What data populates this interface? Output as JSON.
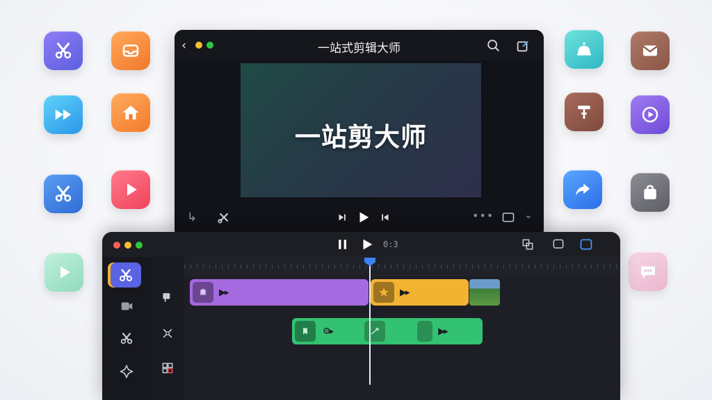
{
  "preview": {
    "title": "一站式剪辑大师",
    "caption": "一站剪大师"
  },
  "timeline": {
    "timecode": "0:3"
  },
  "colors": {
    "accent_blue": "#3d82f2",
    "clip_purple": "#a66ae0",
    "clip_yellow": "#f2b232",
    "clip_green": "#33c271"
  },
  "icons": {
    "left": [
      "scissors-icon",
      "inbox-icon",
      "fast-forward-icon",
      "home-icon",
      "scissors-icon",
      "play-icon",
      "play-icon"
    ],
    "right": [
      "bell-icon",
      "mail-icon",
      "trim-icon",
      "play-circle-icon",
      "share-arrow-icon",
      "bag-icon",
      "chat-icon"
    ]
  }
}
